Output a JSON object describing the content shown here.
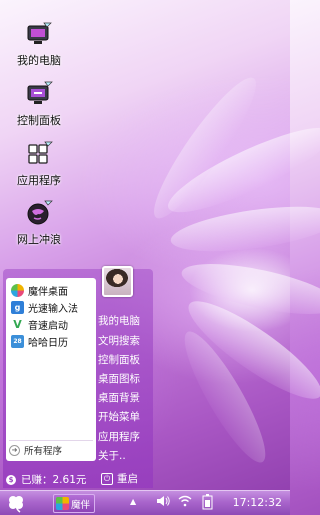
{
  "desktop": {
    "icons": [
      {
        "label": "我的电脑",
        "icon": "my-computer-icon"
      },
      {
        "label": "控制面板",
        "icon": "control-panel-icon"
      },
      {
        "label": "应用程序",
        "icon": "applications-icon"
      },
      {
        "label": "网上冲浪",
        "icon": "internet-globe-icon"
      }
    ]
  },
  "start_menu": {
    "left_items": [
      {
        "label": "魔伴桌面",
        "icon": "mobile-desktop-icon",
        "color": "#f0b400"
      },
      {
        "label": "光速输入法",
        "icon": "input-method-icon",
        "color": "#2f7fd8"
      },
      {
        "label": "音速启动",
        "icon": "sonic-launcher-icon",
        "color": "#33a852"
      },
      {
        "label": "哈哈日历",
        "icon": "calendar-icon",
        "color": "#3b8fd9"
      }
    ],
    "all_programs": "所有程序",
    "right_items": [
      "我的电脑",
      "文明搜索",
      "控制面板",
      "桌面图标",
      "桌面背景",
      "开始菜单",
      "应用程序",
      "关于.."
    ],
    "balance": "已赚：2.61元",
    "restart": "重启"
  },
  "taskbar": {
    "start_icon": "clover-start-icon",
    "app_label": "魔伴",
    "tray_icons": [
      "up-arrow-icon",
      "volume-icon",
      "wifi-icon",
      "battery-icon"
    ],
    "clock": "17:12:32"
  }
}
